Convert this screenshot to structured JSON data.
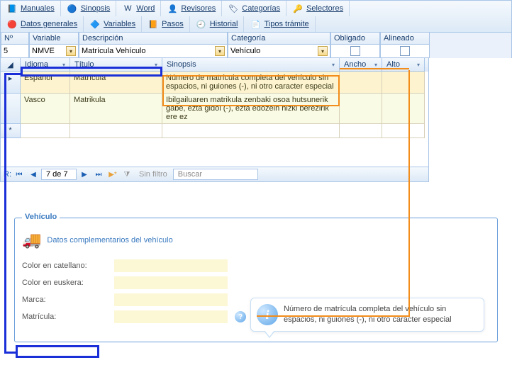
{
  "toolbar": {
    "r1": [
      {
        "icon": "📘",
        "label": "Manuales"
      },
      {
        "icon": "🔵",
        "label": "Sinopsis"
      },
      {
        "icon": "W",
        "label": "Word"
      },
      {
        "icon": "👤",
        "label": "Revisores"
      },
      {
        "icon": "🏷",
        "label": "Categorías"
      },
      {
        "icon": "🔑",
        "label": "Selectores"
      }
    ],
    "r2": [
      {
        "icon": "🔴",
        "label": "Datos generales"
      },
      {
        "icon": "🔷",
        "label": "Variables"
      },
      {
        "icon": "📙",
        "label": "Pasos"
      },
      {
        "icon": "🕘",
        "label": "Historial"
      },
      {
        "icon": "📄",
        "label": "Tipos trámite"
      }
    ]
  },
  "fields": {
    "no": {
      "h": "Nº",
      "v": "5"
    },
    "variable": {
      "h": "Variable",
      "v": "NMVE"
    },
    "desc": {
      "h": "Descripción",
      "v": "Matrícula Vehículo"
    },
    "cat": {
      "h": "Categoría",
      "v": "Vehículo"
    },
    "oblig": {
      "h": "Obligado"
    },
    "align": {
      "h": "Alineado"
    }
  },
  "gridhdr": {
    "idioma": "Idioma",
    "titulo": "Título",
    "sinopsis": "Sinopsis",
    "ancho": "Ancho",
    "alto": "Alto"
  },
  "rows": [
    {
      "idioma": "Español",
      "titulo": "Matrícula",
      "sinopsis": "Número de matrícula completa del vehículo sin espacios, ni guiones (-), ni otro caracter especial"
    },
    {
      "idioma": "Vasco",
      "titulo": "Matrikula",
      "sinopsis": "Ibilgailuaren matrikula zenbaki osoa hutsunerik gabe, ezta gidoi (-), ezta edozein hizki berezirik ere ez"
    }
  ],
  "nav": {
    "label": "R:",
    "pos": "7 de 7",
    "filter": "Sin filtro",
    "search": "Buscar"
  },
  "section": {
    "legend": "Vehículo",
    "subtitle": "Datos complementarios del vehículo",
    "labels": {
      "colorEs": "Color en catellano:",
      "colorEu": "Color en euskera:",
      "marca": "Marca:",
      "matricula": "Matrícula:"
    },
    "tooltip": "Número de matrícula completa del vehículo sin espacios, ni guiones (-), ni otro caracter especial"
  }
}
